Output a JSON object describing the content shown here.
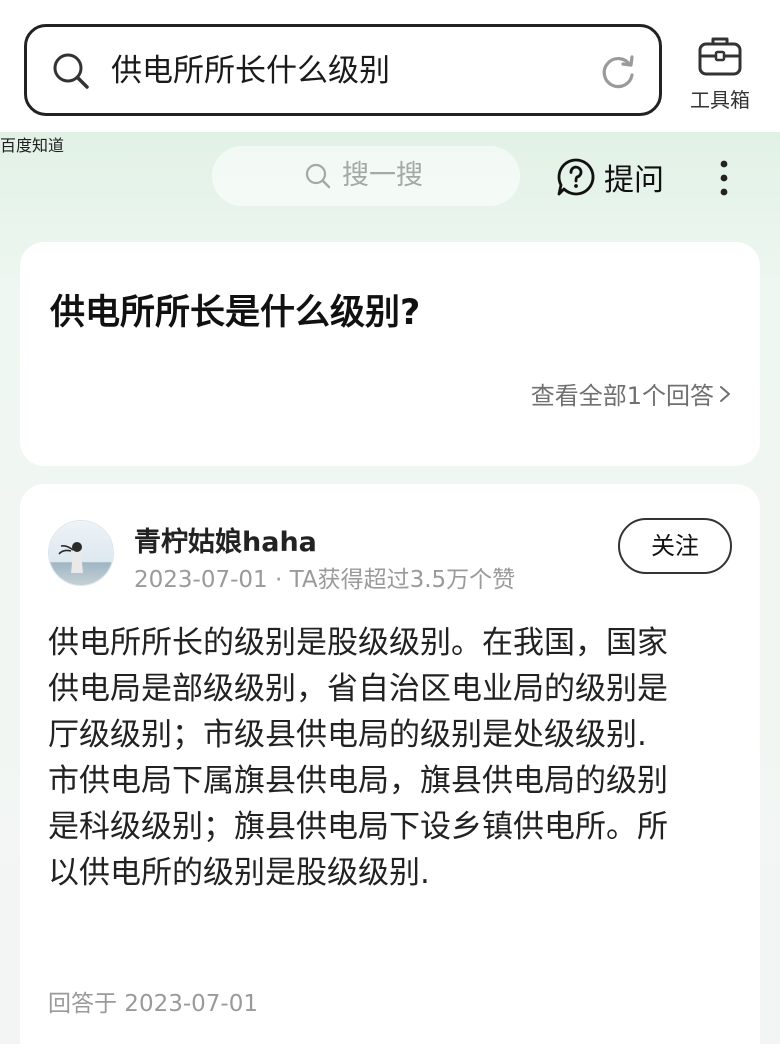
{
  "search": {
    "query": "供电所所长什么级别"
  },
  "toolbox": {
    "label": "工具箱"
  },
  "nav": {
    "logo": "百度知道",
    "search_placeholder": "搜一搜",
    "ask_label": "提问"
  },
  "question": {
    "title": "供电所所长是什么级别?",
    "view_all": "查看全部1个回答"
  },
  "answer": {
    "author": "青柠姑娘haha",
    "meta": "2023-07-01 · TA获得超过3.5万个赞",
    "follow_label": "关注",
    "lines": [
      "供电所所长的级别是股级级别。在我国，国家",
      "供电局是部级级别，省自治区电业局的级别是",
      "厅级级别；市级县供电局的级别是处级级别.",
      "市供电局下属旗县供电局，旗县供电局的级别",
      "是科级级别；旗县供电局下设乡镇供电所。所",
      "以供电所的级别是股级级别."
    ],
    "answered_at": "回答于 2023-07-01"
  },
  "colors": {
    "header_gradient_top": "#e2f1e6",
    "card": "#ffffff",
    "muted_text": "#9a9a9a"
  }
}
